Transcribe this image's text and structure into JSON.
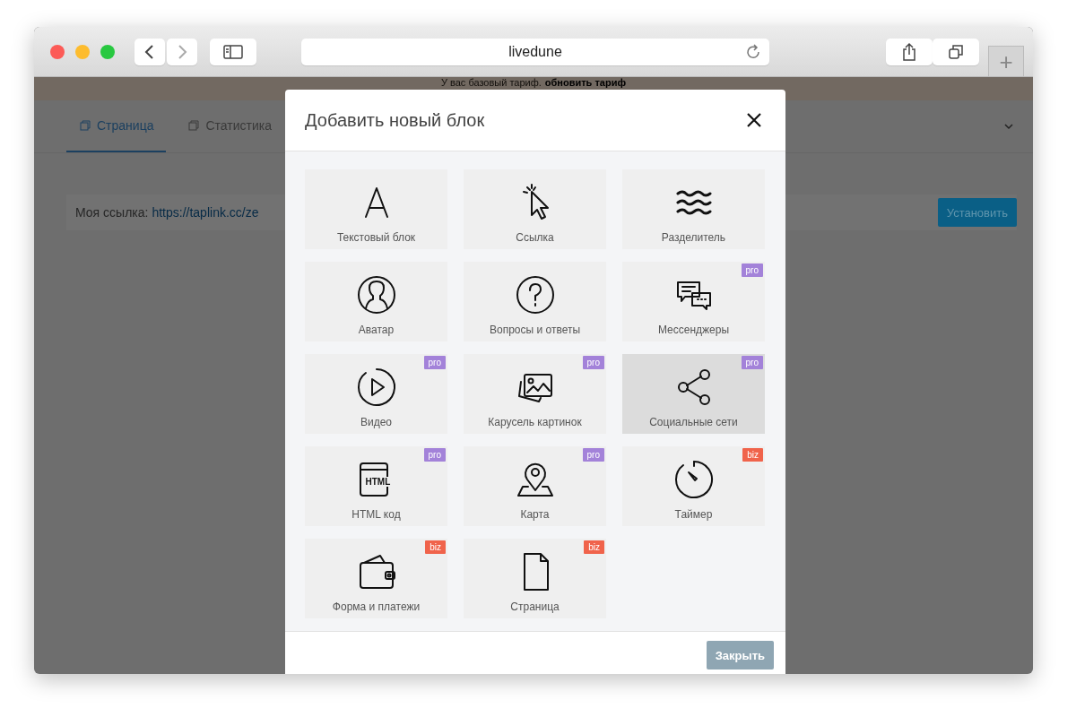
{
  "browser": {
    "address": "livedune",
    "new_tab": "+"
  },
  "banner": {
    "text": "У вас базовый тариф.",
    "link": "обновить тариф"
  },
  "tabs": [
    {
      "label": "Страница",
      "selected": true
    },
    {
      "label": "Статистика",
      "selected": false
    }
  ],
  "link_bar": {
    "label": "Моя ссылка:",
    "url": "https://taplink.cc/ze",
    "button": "Установить"
  },
  "modal": {
    "title": "Добавить новый блок",
    "close": "Закрыть",
    "blocks": [
      {
        "kind": "text",
        "label": "Текстовый блок",
        "selected": false
      },
      {
        "kind": "link",
        "label": "Ссылка",
        "selected": false
      },
      {
        "kind": "divider",
        "label": "Разделитель",
        "selected": false
      },
      {
        "kind": "avatar",
        "label": "Аватар",
        "selected": false
      },
      {
        "kind": "faq",
        "label": "Вопросы и ответы",
        "selected": false
      },
      {
        "kind": "messengers",
        "label": "Мессенджеры",
        "selected": false,
        "badge": {
          "label": "pro",
          "color": "#a382d9"
        }
      },
      {
        "kind": "video",
        "label": "Видео",
        "selected": false,
        "badge": {
          "label": "pro",
          "color": "#a382d9"
        }
      },
      {
        "kind": "carousel",
        "label": "Карусель картинок",
        "selected": false,
        "badge": {
          "label": "pro",
          "color": "#a382d9"
        }
      },
      {
        "kind": "social",
        "label": "Социальные сети",
        "selected": true,
        "badge": {
          "label": "pro",
          "color": "#a382d9"
        }
      },
      {
        "kind": "html",
        "icon_text": "HTML",
        "label": "HTML код",
        "selected": false,
        "badge": {
          "label": "pro",
          "color": "#a382d9"
        }
      },
      {
        "kind": "map",
        "label": "Карта",
        "selected": false,
        "badge": {
          "label": "pro",
          "color": "#a382d9"
        }
      },
      {
        "kind": "timer",
        "label": "Таймер",
        "selected": false,
        "badge": {
          "label": "biz",
          "color": "#f0634b"
        }
      },
      {
        "kind": "payment",
        "label": "Форма и платежи",
        "selected": false,
        "badge": {
          "label": "biz",
          "color": "#f0634b"
        }
      },
      {
        "kind": "page",
        "label": "Страница",
        "selected": false,
        "badge": {
          "label": "biz",
          "color": "#f0634b"
        }
      }
    ]
  }
}
